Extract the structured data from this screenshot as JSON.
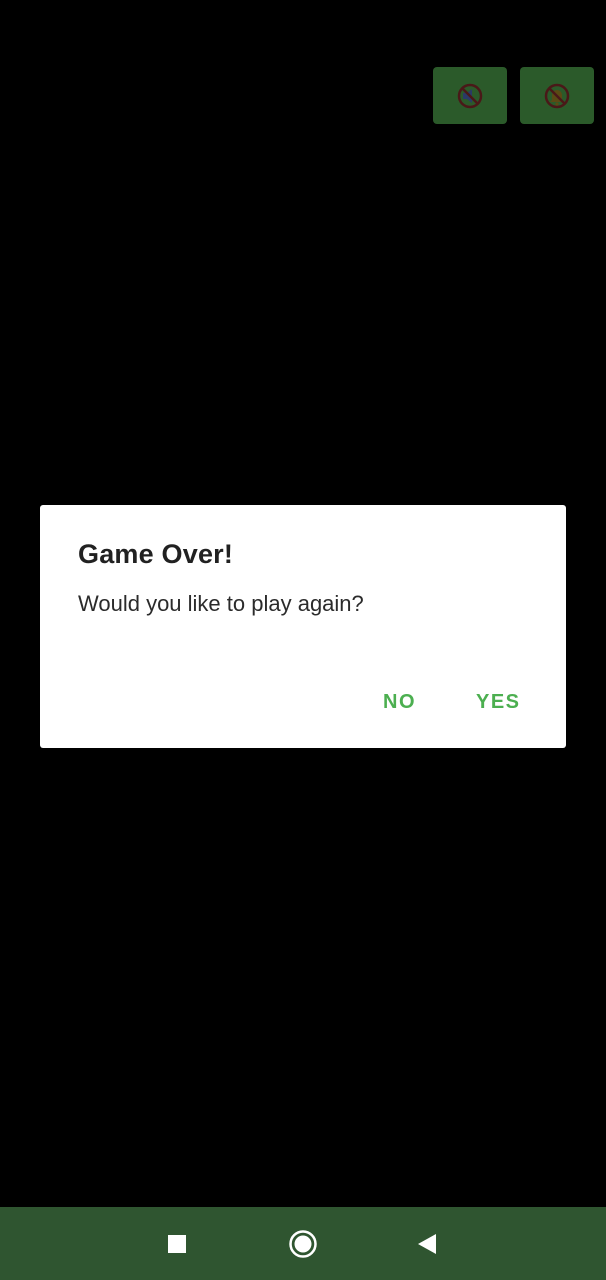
{
  "toolbar": {
    "sound_icon": "speaker-muted-icon",
    "notification_icon": "bell-off-icon",
    "button_color": "#2b5a2a"
  },
  "dialog": {
    "title": "Game Over!",
    "message": "Would you like to play again?",
    "negative_label": "NO",
    "positive_label": "YES",
    "button_color": "#4caf50"
  },
  "navbar": {
    "background": "#2f5530",
    "recents_icon": "square-icon",
    "home_icon": "circle-icon",
    "back_icon": "triangle-back-icon"
  }
}
